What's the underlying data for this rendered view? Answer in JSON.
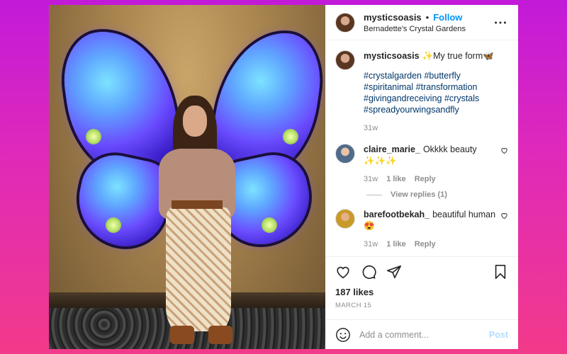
{
  "post": {
    "author": {
      "username": "mysticsoasis",
      "follow_label": "Follow",
      "location": "Bernadette's Crystal Gardens",
      "separator": "•"
    },
    "caption": {
      "username": "mysticsoasis",
      "text": "✨My true form🦋",
      "hashtags": "#crystalgarden #butterfly #spiritanimal #transformation #givingandreceiving #crystals #spreadyourwingsandfly",
      "time": "31w"
    },
    "comments": [
      {
        "username": "claire_marie_",
        "text": "Okkkk beauty ✨✨✨",
        "time": "31w",
        "likes": "1 like",
        "reply_label": "Reply",
        "view_replies": "View replies (1)"
      },
      {
        "username": "barefootbekah_",
        "text": "beautiful human 😍",
        "time": "31w",
        "likes": "1 like",
        "reply_label": "Reply"
      }
    ],
    "likes": "187 likes",
    "date": "MARCH 15",
    "add_comment_placeholder": "Add a comment...",
    "post_label": "Post"
  },
  "icons": {
    "like": "heart-icon",
    "comment": "comment-icon",
    "share": "share-icon",
    "save": "bookmark-icon",
    "emoji": "emoji-icon",
    "more": "more-options-icon"
  },
  "colors": {
    "link": "#0095f6",
    "hashtag": "#00376b",
    "muted": "#8e8e8e",
    "background_top": "#c21ad9",
    "background_bottom": "#f23a8a"
  }
}
